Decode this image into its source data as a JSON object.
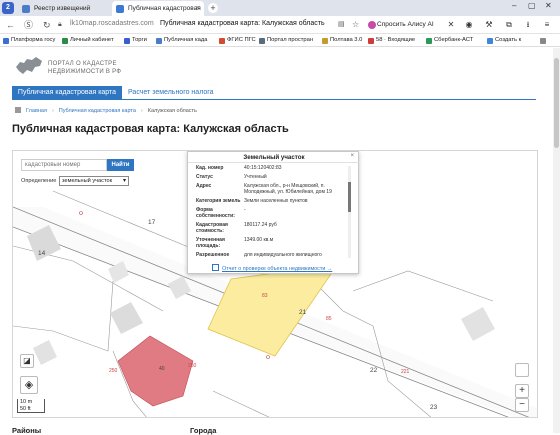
{
  "browser": {
    "tab_count": "2",
    "tabs": [
      {
        "title": "Реестр извещений"
      },
      {
        "title": "Публичная кадастровая"
      }
    ],
    "url_domain": "lk10map.roscadastres.com",
    "page_title": "Публичная кадастровая карта: Калужская область",
    "alice_label": "Спросить Алису AI",
    "bookmarks": [
      {
        "label": "Платформа госу",
        "color": "#3b6fd1"
      },
      {
        "label": "Личный кабинет",
        "color": "#2d8c4a"
      },
      {
        "label": "Торги",
        "color": "#3a5fcc"
      },
      {
        "label": "Публичная када",
        "color": "#4a7cc8"
      },
      {
        "label": "ФГИС ПГС",
        "color": "#d14d2e"
      },
      {
        "label": "Портал простран",
        "color": "#5a6b7d"
      },
      {
        "label": "Полтава 3.0",
        "color": "#c79a2c"
      },
      {
        "label": "58 · Входящие",
        "color": "#d23b3b"
      },
      {
        "label": "Сбербанк-АСТ",
        "color": "#2a9a57"
      },
      {
        "label": "Создать к",
        "color": "#3f86d6"
      }
    ]
  },
  "header": {
    "logo_line1": "ПОРТАЛ О КАДАСТРЕ",
    "logo_line2": "НЕДВИЖИМОСТИ В РФ",
    "tab_active": "Публичная кадастровая карта",
    "tab_other": "Расчет земельного налога"
  },
  "breadcrumb": {
    "home": "Главная",
    "section": "Публичная кадастровая карта",
    "current": "Калужская область"
  },
  "title": "Публичная кадастровая карта: Калужская область",
  "map": {
    "search_placeholder": "кадастровый номер",
    "find_button": "Найти",
    "mode_label": "Определение",
    "mode_value": "земельный участок",
    "labels": {
      "n17": "17",
      "n14": "14",
      "n21": "21",
      "n22": "22",
      "n23": "23",
      "n83": "83",
      "n85": "85",
      "n221": "221",
      "n250a": "250",
      "n250b": "250",
      "n40": "40"
    },
    "scale_m": "10 m",
    "scale_ft": "50 ft",
    "zoom_in": "+",
    "zoom_out": "−"
  },
  "popup": {
    "title": "Земельный участок",
    "close": "×",
    "rows": [
      {
        "k": "Кад. номер",
        "v": "40:15:120402:83"
      },
      {
        "k": "Статус",
        "v": "Учтенный"
      },
      {
        "k": "Адрес",
        "v": "Калужская обл., р-н Мещовский, п. Молодежный, ул. Юбилейная, дом 19"
      },
      {
        "k": "Категория земель",
        "v": "Земли населенных пунктов"
      },
      {
        "k": "Форма собственности:",
        "v": "-"
      },
      {
        "k": "Кадастровая стоимость:",
        "v": "180117.24 руб"
      },
      {
        "k": "Уточненная площадь:",
        "v": "1349.00 кв.м"
      },
      {
        "k": "Разрешенное",
        "v": "для индивидуального жилищного"
      }
    ],
    "report_link": "Отчет о проверке объекта недвижимости →"
  },
  "footer": {
    "left": "Районы",
    "right": "Города"
  }
}
